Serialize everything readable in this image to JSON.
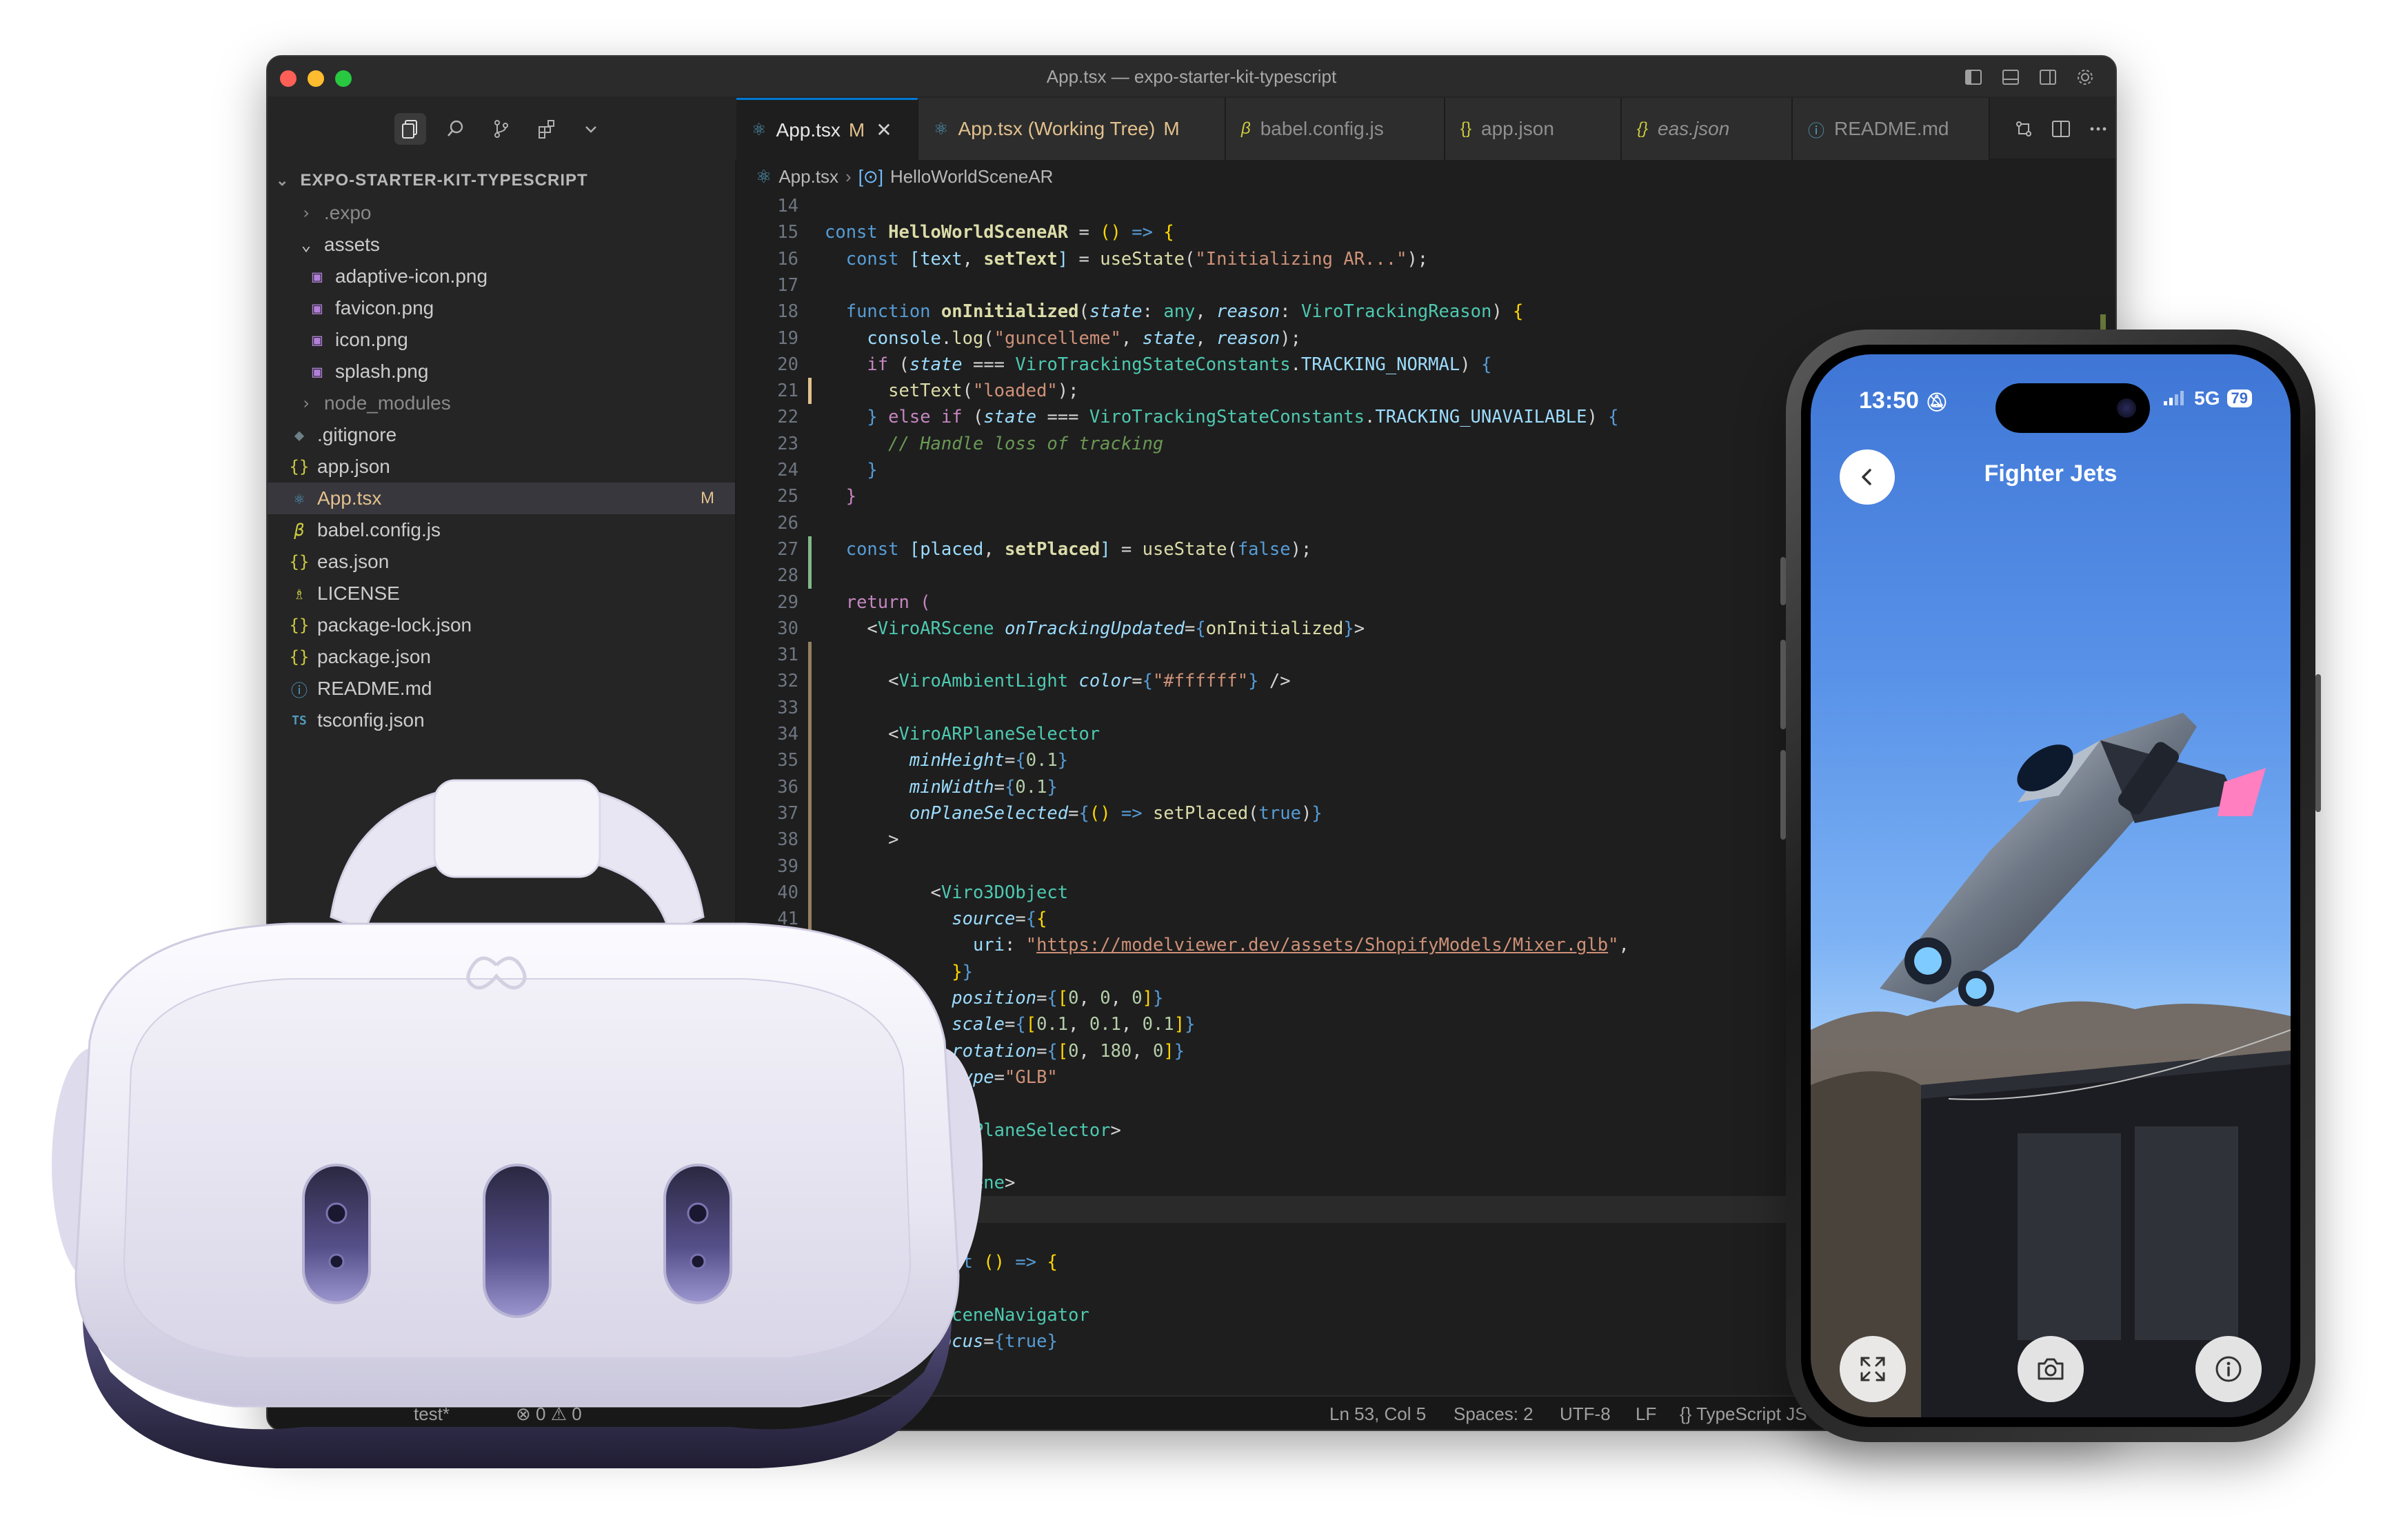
{
  "window": {
    "title": "App.tsx — expo-starter-kit-typescript"
  },
  "explorer": {
    "root": "EXPO-STARTER-KIT-TYPESCRIPT",
    "items": [
      {
        "label": ".expo"
      },
      {
        "label": "assets"
      },
      {
        "label": "adaptive-icon.png"
      },
      {
        "label": "favicon.png"
      },
      {
        "label": "icon.png"
      },
      {
        "label": "splash.png"
      },
      {
        "label": "node_modules"
      },
      {
        "label": ".gitignore"
      },
      {
        "label": "app.json"
      },
      {
        "label": "App.tsx",
        "badge": "M"
      },
      {
        "label": "babel.config.js"
      },
      {
        "label": "eas.json"
      },
      {
        "label": "LICENSE"
      },
      {
        "label": "package-lock.json"
      },
      {
        "label": "package.json"
      },
      {
        "label": "README.md"
      },
      {
        "label": "tsconfig.json"
      }
    ]
  },
  "tabs": [
    {
      "label": "App.tsx",
      "badge": "M",
      "close": "✕"
    },
    {
      "label": "App.tsx (Working Tree)",
      "badge": "M"
    },
    {
      "label": "babel.config.js"
    },
    {
      "label": "app.json"
    },
    {
      "label": "eas.json"
    },
    {
      "label": "README.md"
    }
  ],
  "breadcrumb": {
    "file": "App.tsx",
    "symbol": "HelloWorldSceneAR"
  },
  "status": {
    "branch": "test*",
    "problems": "0",
    "warnings": "0",
    "position": "Ln 53, Col 5",
    "spaces": "Spaces: 2",
    "encoding": "UTF-8",
    "eol": "LF",
    "language": "TypeScript JS"
  },
  "phone": {
    "time": "13:50",
    "network": "5G",
    "battery": "79",
    "app_title": "Fighter Jets"
  },
  "colors": {
    "accent": "#0078d4",
    "modified": "#e2c08d",
    "editor_bg": "#1e1e1e",
    "sidebar_bg": "#252526"
  }
}
